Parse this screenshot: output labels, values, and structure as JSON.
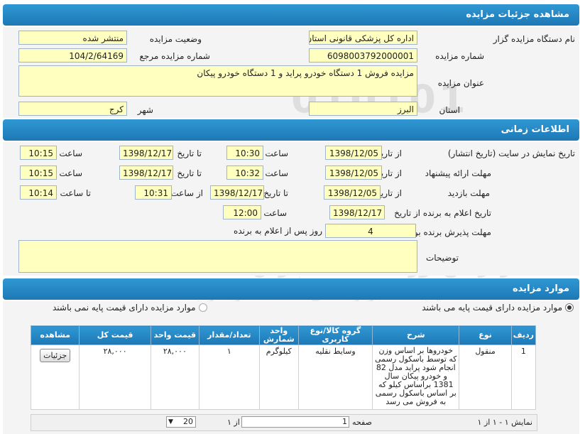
{
  "header": {
    "title": "مشاهده جزئیات مزایده"
  },
  "details": {
    "org_label": "نام دستگاه مزایده گزار",
    "org_value": "اداره کل پزشکی قانونی استان البرز",
    "status_label": "وضعیت مزایده",
    "status_value": "منتشر شده",
    "number_label": "شماره مزایده",
    "number_value": "6098003792000001",
    "ref_label": "شماره مزایده مرجع",
    "ref_value": "104/2/64169",
    "subject_label": "عنوان مزایده",
    "subject_value": "مزایده فروش 1 دستگاه خودرو پراید و 1 دستگاه خودرو پیکان",
    "province_label": "استان",
    "province_value": "البرز",
    "city_label": "شهر",
    "city_value": "کرج"
  },
  "timing": {
    "title": "اطلاعات زمانی",
    "r1_label": "تاریخ نمایش در سایت (تاریخ انتشار)",
    "r2_label": "مهلت ارائه پیشنهاد",
    "r3_label": "مهلت بازدید",
    "r4_label": "تاریخ اعلام به برنده",
    "r5_label": "مهلت پذیرش برنده بودن",
    "from_date": "از تاریخ",
    "to_date": "تا تاریخ",
    "time": "ساعت",
    "from_time": "از ساعت",
    "to_time": "تا ساعت",
    "r1_from": "1398/12/05",
    "r1_time1": "10:30",
    "r1_to": "1398/12/17",
    "r1_time2": "10:15",
    "r2_from": "1398/12/05",
    "r2_time1": "10:32",
    "r2_to": "1398/12/17",
    "r2_time2": "10:15",
    "r3_from": "1398/12/05",
    "r3_to": "1398/12/17",
    "r3_tfrom": "10:31",
    "r3_tto": "10:14",
    "r4_from": "1398/12/17",
    "r4_time": "12:00",
    "r5_value": "4",
    "r5_suffix": "روز پس از اعلام به برنده",
    "notes_label": "توضیحات",
    "notes_value": ""
  },
  "items": {
    "title": "موارد مزایده",
    "radio1": "موارد مزایده دارای قیمت پایه می باشند",
    "radio2": "موارد مزایده دارای قیمت پایه نمی باشند",
    "columns": [
      "ردیف",
      "نوع",
      "شرح",
      "گروه کالا/نوع کاربری",
      "واحد شمارش",
      "تعداد/مقدار",
      "قیمت واحد",
      "قیمت کل",
      "مشاهده"
    ],
    "row": {
      "index": "1",
      "type": "منقول",
      "desc": "خودروها بر اساس وزن که توسط باسکول رسمی انجام شود پراید مدل 82  و خودرو پیکان سال 1381 براساس کیلو که بر اساس باسکول رسمی به فروش می رسد",
      "group": "وسایط نقلیه",
      "unit": "کیلوگرم",
      "qty": "۱",
      "unit_price": "۲۸,۰۰۰",
      "total": "۲۸,۰۰۰",
      "action": "جزئیات"
    },
    "pager": {
      "summary": "نمایش ۱ - ۱ از ۱",
      "page_label": "صفحه",
      "page_value": "1",
      "of_label": "از ۱",
      "page_size": "20"
    }
  },
  "watermark": {
    "line1": "ParsNamadData",
    "line2": "مرکز فن آوری اطلاعات پارس نماد داده ها",
    "line3": "پایگاه خبر رسانی مناقصه و مزایده",
    "line4": "۰۲۱-۸۸۳۴۹۶۷۰-۵"
  },
  "colors": {
    "header_blue": "#1d78b5",
    "field_yellow": "#ffffc0",
    "panel": "#f4f4f4"
  }
}
